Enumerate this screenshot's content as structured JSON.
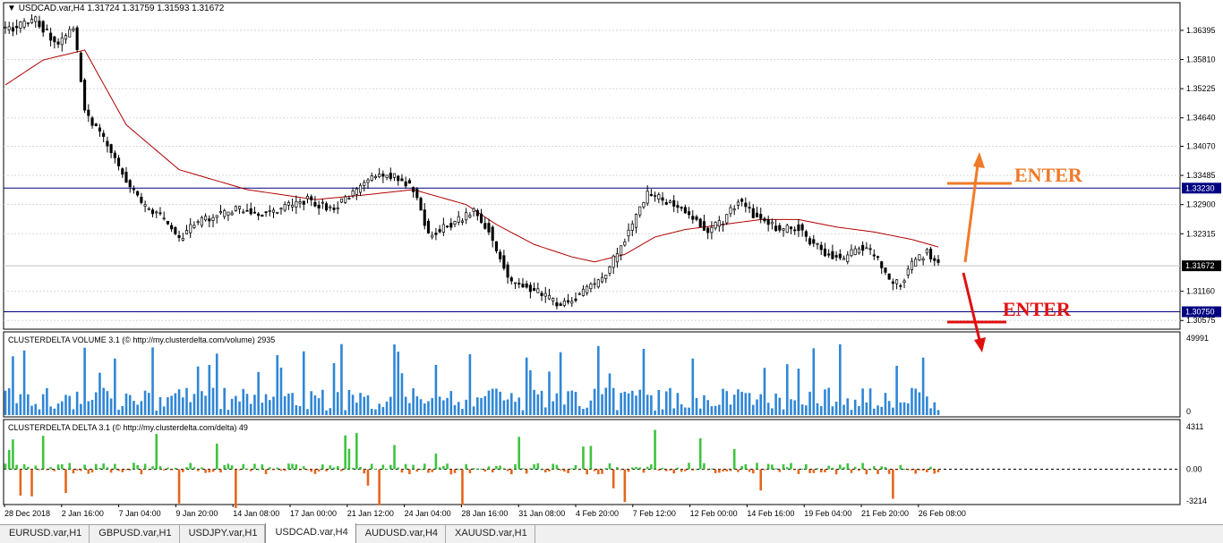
{
  "header": {
    "symbol_caption": "USDCAD.var,H4",
    "ohlc": "1.31724 1.31759 1.31593 1.31672"
  },
  "indicators": {
    "volume_title": "CLUSTERDELTA VOLUME 3.1 (© http://my.clusterdelta.com/volume) 2935",
    "delta_title": "CLUSTERDELTA DELTA 3.1 (© http://my.clusterdelta.com/delta) 49"
  },
  "annotations": {
    "enter_top": "ENTER",
    "enter_bottom": "ENTER",
    "enter_top_color": "#f07a28",
    "enter_bottom_color": "#e01010"
  },
  "colors": {
    "candle": "#000000",
    "ma": "#b00000",
    "hline": "#000080",
    "volume_bar": "#2f86d6",
    "delta_pos": "#3ec43e",
    "delta_neg": "#e4661e"
  },
  "tabs": [
    {
      "label": "EURUSD.var,H1",
      "active": false
    },
    {
      "label": "GBPUSD.var,H1",
      "active": false
    },
    {
      "label": "USDJPY.var,H1",
      "active": false
    },
    {
      "label": "USDCAD.var,H4",
      "active": true
    },
    {
      "label": "AUDUSD.var,H4",
      "active": false
    },
    {
      "label": "XAUUSD.var,H1",
      "active": false
    }
  ],
  "chart_data": [
    {
      "type": "candlestick",
      "title": "USDCAD.var,H4",
      "ylim": [
        1.304,
        1.3695
      ],
      "y_ticks": [
        "1.36395",
        "1.35810",
        "1.35225",
        "1.34640",
        "1.34070",
        "1.33485",
        "1.32900",
        "1.32315",
        "1.31160",
        "1.30575"
      ],
      "price_labels": [
        {
          "value": 1.3323,
          "label": "1.33230"
        },
        {
          "value": 1.31672,
          "label": "1.31672"
        },
        {
          "value": 1.3075,
          "label": "1.30750"
        }
      ],
      "horizontal_lines": [
        1.3323,
        1.3075
      ],
      "x_ticks": [
        "28 Dec 2018",
        "2 Jan 16:00",
        "7 Jan 04:00",
        "9 Jan 20:00",
        "14 Jan 08:00",
        "17 Jan 00:00",
        "21 Jan 12:00",
        "24 Jan 04:00",
        "28 Jan 16:00",
        "31 Jan 08:00",
        "4 Feb 20:00",
        "7 Feb 12:00",
        "12 Feb 00:00",
        "14 Feb 16:00",
        "19 Feb 04:00",
        "21 Feb 20:00",
        "26 Feb 08:00"
      ],
      "close_path": [
        [
          0,
          1.364
        ],
        [
          8,
          1.366
        ],
        [
          14,
          1.361
        ],
        [
          18,
          1.365
        ],
        [
          21,
          1.348
        ],
        [
          26,
          1.342
        ],
        [
          32,
          1.334
        ],
        [
          36,
          1.329
        ],
        [
          42,
          1.326
        ],
        [
          46,
          1.322
        ],
        [
          50,
          1.325
        ],
        [
          56,
          1.327
        ],
        [
          62,
          1.328
        ],
        [
          68,
          1.327
        ],
        [
          74,
          1.3285
        ],
        [
          80,
          1.33
        ],
        [
          86,
          1.328
        ],
        [
          92,
          1.331
        ],
        [
          96,
          1.334
        ],
        [
          100,
          1.335
        ],
        [
          104,
          1.3345
        ],
        [
          108,
          1.332
        ],
        [
          112,
          1.323
        ],
        [
          118,
          1.325
        ],
        [
          124,
          1.3275
        ],
        [
          128,
          1.324
        ],
        [
          130,
          1.32
        ],
        [
          134,
          1.313
        ],
        [
          138,
          1.3125
        ],
        [
          142,
          1.311
        ],
        [
          146,
          1.309
        ],
        [
          150,
          1.31
        ],
        [
          154,
          1.312
        ],
        [
          158,
          1.314
        ],
        [
          161,
          1.318
        ],
        [
          166,
          1.325
        ],
        [
          170,
          1.331
        ],
        [
          174,
          1.33
        ],
        [
          178,
          1.329
        ],
        [
          182,
          1.326
        ],
        [
          186,
          1.324
        ],
        [
          190,
          1.3255
        ],
        [
          194,
          1.33
        ],
        [
          198,
          1.327
        ],
        [
          202,
          1.325
        ],
        [
          206,
          1.324
        ],
        [
          210,
          1.3245
        ],
        [
          214,
          1.321
        ],
        [
          218,
          1.319
        ],
        [
          222,
          1.318
        ],
        [
          226,
          1.3205
        ],
        [
          230,
          1.319
        ],
        [
          234,
          1.314
        ],
        [
          237,
          1.313
        ],
        [
          240,
          1.317
        ],
        [
          244,
          1.3195
        ],
        [
          246,
          1.318
        ],
        [
          247,
          1.3167
        ]
      ],
      "ma_path": [
        [
          0,
          1.353
        ],
        [
          10,
          1.358
        ],
        [
          21,
          1.36
        ],
        [
          32,
          1.345
        ],
        [
          46,
          1.336
        ],
        [
          64,
          1.332
        ],
        [
          82,
          1.33
        ],
        [
          96,
          1.331
        ],
        [
          108,
          1.332
        ],
        [
          122,
          1.329
        ],
        [
          130,
          1.325
        ],
        [
          140,
          1.321
        ],
        [
          150,
          1.3185
        ],
        [
          156,
          1.3175
        ],
        [
          164,
          1.319
        ],
        [
          172,
          1.3225
        ],
        [
          180,
          1.324
        ],
        [
          190,
          1.325
        ],
        [
          200,
          1.326
        ],
        [
          210,
          1.326
        ],
        [
          220,
          1.3245
        ],
        [
          230,
          1.3235
        ],
        [
          240,
          1.322
        ],
        [
          247,
          1.3205
        ]
      ]
    },
    {
      "type": "bar",
      "title": "CLUSTERDELTA VOLUME 3.1",
      "ylim": [
        0,
        49991
      ],
      "y_ticks": [
        "49991",
        "0"
      ],
      "last_value": 2935
    },
    {
      "type": "bar",
      "title": "CLUSTERDELTA DELTA 3.1",
      "ylim": [
        -3214,
        4311
      ],
      "y_ticks": [
        "4311",
        "0.00",
        "-3214"
      ],
      "zero_line": 0,
      "last_value": 49
    }
  ]
}
